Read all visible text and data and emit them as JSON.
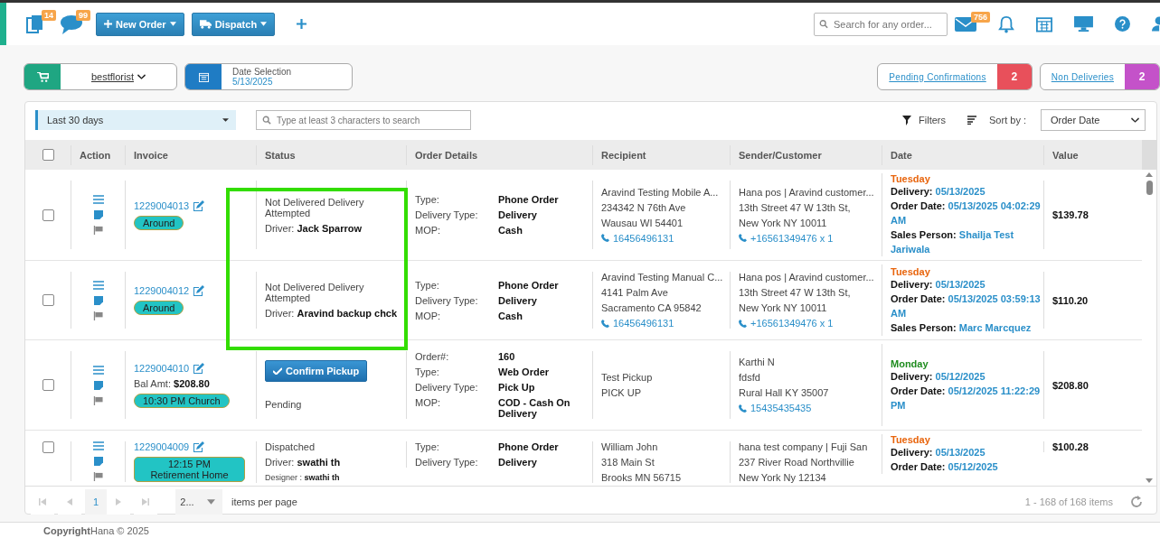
{
  "topbar": {
    "badges": [
      {
        "kind": "orders",
        "count": "14"
      },
      {
        "kind": "messages",
        "count": "99"
      }
    ],
    "buttons": [
      {
        "kind": "new",
        "label": "New Order"
      },
      {
        "kind": "dispatch",
        "label": "Dispatch"
      }
    ],
    "search": {
      "placeholder": "Search for any order..."
    },
    "mail_count": "756"
  },
  "summary": {
    "store": "bestflorist",
    "date_label": "Date Selection",
    "date": "5/13/2025",
    "counters": [
      {
        "label": "Pending Confirmations",
        "count": "2",
        "color": "#e8505b"
      },
      {
        "label": "Non Deliveries",
        "count": "2",
        "color": "#c452c9"
      }
    ]
  },
  "orders": {
    "range": "Last 30 days",
    "search": {
      "placeholder": "Type at least 3 characters to search"
    },
    "filters": "Filters",
    "sort_label": "Sort by :",
    "sort_value": "Order Date",
    "header_checked": false,
    "columns": [
      "Action",
      "Invoice",
      "Status",
      "Order Details",
      "Recipient",
      "Sender/Customer",
      "Date",
      "Value"
    ],
    "rows": [
      {
        "checked": false,
        "invoice": "1229004013",
        "tag": "Around",
        "status": [
          {
            "kind": "text",
            "text": "Not Delivered Delivery Attempted"
          },
          {
            "kind": "field",
            "label": "Driver:",
            "value": "Jack Sparrow"
          }
        ],
        "details": [
          {
            "label": "Type:",
            "value": "Phone Order"
          },
          {
            "label": "Delivery Type:",
            "value": "Delivery"
          },
          {
            "label": "MOP:",
            "value": "Cash"
          }
        ],
        "recipient": [
          "Aravind Testing Mobile A...",
          "234342 N 76th Ave",
          "Wausau WI 54401"
        ],
        "recipient_phone": "16456496131",
        "sender": [
          "Hana pos | Aravind customer...",
          "13th Street 47 W 13th St,",
          "New York NY 10011"
        ],
        "sender_phone": "+16561349476 x 1",
        "day": {
          "text": "Tuesday",
          "color": "#e8640c"
        },
        "dates": [
          {
            "label": "Delivery:",
            "value": "05/13/2025"
          },
          {
            "label": "Order Date:",
            "value": "05/13/2025 04:02:29 AM"
          },
          {
            "label": "Sales Person:",
            "value": "Shailja Test Jariwala"
          }
        ],
        "value": "$139.78"
      },
      {
        "checked": false,
        "invoice": "1229004012",
        "tag": "Around",
        "status": [
          {
            "kind": "text",
            "text": "Not Delivered Delivery Attempted"
          },
          {
            "kind": "field",
            "label": "Driver:",
            "value": "Aravind backup chck"
          }
        ],
        "details": [
          {
            "label": "Type:",
            "value": "Phone Order"
          },
          {
            "label": "Delivery Type:",
            "value": "Delivery"
          },
          {
            "label": "MOP:",
            "value": "Cash"
          }
        ],
        "recipient": [
          "Aravind Testing Manual C...",
          "4141 Palm Ave",
          "Sacramento CA 95842"
        ],
        "recipient_phone": "16456496131",
        "sender": [
          "Hana pos | Aravind customer...",
          "13th Street 47 W 13th St,",
          "New York NY 10011"
        ],
        "sender_phone": "+16561349476 x 1",
        "day": {
          "text": "Tuesday",
          "color": "#e8640c"
        },
        "dates": [
          {
            "label": "Delivery:",
            "value": "05/13/2025"
          },
          {
            "label": "Order Date:",
            "value": "05/13/2025 03:59:13 AM"
          },
          {
            "label": "Sales Person:",
            "value": "Marc Marcquez"
          }
        ],
        "value": "$110.20"
      },
      {
        "checked": false,
        "invoice": "1229004010",
        "balance": {
          "label": "Bal Amt:",
          "value": "$208.80"
        },
        "tag": "10:30 PM Church",
        "status": [
          {
            "kind": "button",
            "label": "Confirm Pickup"
          },
          {
            "kind": "text",
            "text": "Pending"
          }
        ],
        "details": [
          {
            "label": "Order#:",
            "value": "160"
          },
          {
            "label": "Type:",
            "value": "Web Order"
          },
          {
            "label": "Delivery Type:",
            "value": "Pick Up"
          },
          {
            "label": "MOP:",
            "value": "COD - Cash On Delivery"
          }
        ],
        "recipient": [
          "Test Pickup",
          "PICK UP"
        ],
        "sender": [
          "Karthi N",
          "fdsfd",
          "Rural Hall KY 35007"
        ],
        "sender_phone": "15435435435",
        "day": {
          "text": "Monday",
          "color": "#1e8c1e"
        },
        "dates": [
          {
            "label": "Delivery:",
            "value": "05/12/2025"
          },
          {
            "label": "Order Date:",
            "value": "05/12/2025 11:22:29 PM"
          }
        ],
        "value": "$208.80"
      },
      {
        "checked": false,
        "invoice": "1229004009",
        "tag": "12:15 PM Retirement Home",
        "status": [
          {
            "kind": "text",
            "text": "Dispatched"
          },
          {
            "kind": "field",
            "label": "Driver:",
            "value": "swathi th"
          },
          {
            "kind": "small",
            "label": "Designer :",
            "value": "swathi th"
          }
        ],
        "details": [
          {
            "label": "Type:",
            "value": "Phone Order"
          },
          {
            "label": "Delivery Type:",
            "value": "Delivery"
          }
        ],
        "recipient": [
          "William John",
          "318 Main St",
          "Brooks MN 56715"
        ],
        "sender": [
          "hana test company | Fuji San",
          "237 River Road Northvillie",
          "New York Ny 12134"
        ],
        "day": {
          "text": "Tuesday",
          "color": "#e8640c"
        },
        "dates": [
          {
            "label": "Delivery:",
            "value": "05/13/2025"
          },
          {
            "label": "Order Date:",
            "value": "05/12/2025"
          }
        ],
        "value": "$100.28"
      }
    ],
    "annotation": {
      "kind": "box"
    },
    "pager": {
      "page": "1",
      "per_page": "2...",
      "per_page_label": "items per page",
      "range": "1 - 168 of 168 items"
    }
  },
  "footer": {
    "text": "**Copyright**Hana © 2025"
  }
}
